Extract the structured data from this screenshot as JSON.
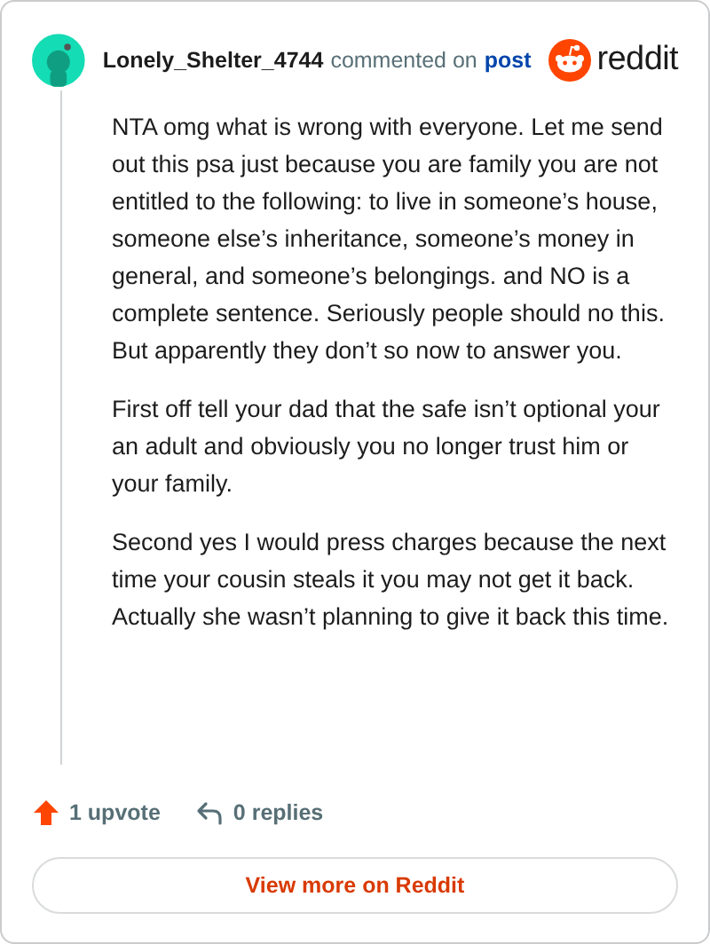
{
  "comment": {
    "author": "Lonely_Shelter_4744",
    "action": "commented on",
    "link": "post",
    "brand": "reddit",
    "paragraphs": [
      "NTA omg what is wrong with everyone. Let me send out this psa just because you are family you are not entitled to the following: to live in someone’s house, someone else’s inheritance, someone’s money in general, and someone’s belongings. and NO is a complete sentence. Seriously people should no this. But apparently they don’t so now to answer you.",
      "First off tell your dad that the safe isn’t optional your an adult and obviously you no longer trust him or your family.",
      "Second yes I would press charges because the next time your cousin steals it you may not get it back. Actually she wasn’t planning to give it back this time."
    ],
    "upvotes": "1 upvote",
    "replies": "0 replies"
  },
  "button": "View more on Reddit"
}
